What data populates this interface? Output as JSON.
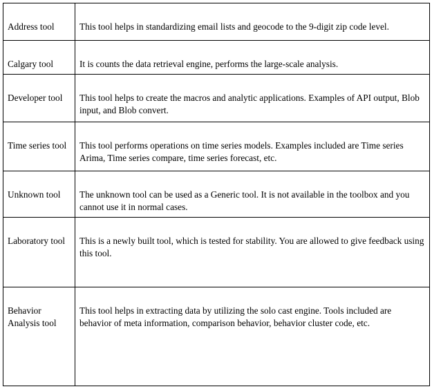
{
  "rows": [
    {
      "tool": "Address tool",
      "description": "This tool helps in standardizing email lists and geocode to the 9-digit zip code level."
    },
    {
      "tool": "Calgary tool",
      "description": "It is counts the data retrieval engine, performs the large-scale analysis."
    },
    {
      "tool": "Developer tool",
      "description": "This tool helps to create the macros and analytic applications. Examples of API output, Blob input, and Blob convert."
    },
    {
      "tool": "Time series tool",
      "description": "This tool performs operations on time series models. Examples included are Time series Arima, Time series compare,  time series forecast, etc."
    },
    {
      "tool": "Unknown tool",
      "description": "The unknown tool can be used as a Generic tool. It is not available in the toolbox and you cannot use it in normal cases."
    },
    {
      "tool": "Laboratory tool",
      "description": "This is a newly built tool, which is tested for stability. You are allowed to give feedback using this tool."
    },
    {
      "tool": "Behavior Analysis tool",
      "description": "This tool helps in extracting data by utilizing the solo cast engine. Tools included are behavior of meta information, comparison behavior, behavior cluster code, etc."
    }
  ]
}
